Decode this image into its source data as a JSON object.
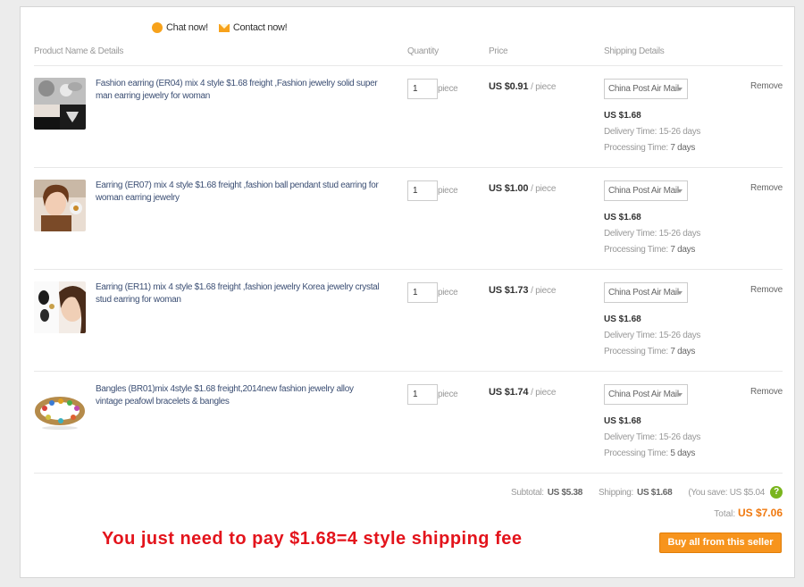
{
  "seller": {
    "chat_label": "Chat now!",
    "contact_label": "Contact now!"
  },
  "columns": {
    "product": "Product Name & Details",
    "quantity": "Quantity",
    "price": "Price",
    "shipping": "Shipping Details"
  },
  "items": [
    {
      "title": "Fashion earring (ER04) mix 4 style $1.68 freight ,Fashion jewelry solid super man earring jewelry for woman",
      "quantity": "1",
      "unit": "piece",
      "price": "US $0.91",
      "per": "/ piece",
      "shipping_method": "China Post Air Mail",
      "shipping_cost": "US $1.68",
      "delivery_label": "Delivery Time:",
      "delivery_time": "15-26 days",
      "processing_label": "Processing Time:",
      "processing_time": "7 days",
      "remove_label": "Remove"
    },
    {
      "title": "Earring (ER07) mix 4 style $1.68 freight ,fashion ball pendant stud earring for woman earring jewelry",
      "quantity": "1",
      "unit": "piece",
      "price": "US $1.00",
      "per": "/ piece",
      "shipping_method": "China Post Air Mail",
      "shipping_cost": "US $1.68",
      "delivery_label": "Delivery Time:",
      "delivery_time": "15-26 days",
      "processing_label": "Processing Time:",
      "processing_time": "7 days",
      "remove_label": "Remove"
    },
    {
      "title": "Earring (ER11) mix 4 style $1.68 freight ,fashion jewelry Korea jewelry crystal stud earring for woman",
      "quantity": "1",
      "unit": "piece",
      "price": "US $1.73",
      "per": "/ piece",
      "shipping_method": "China Post Air Mail",
      "shipping_cost": "US $1.68",
      "delivery_label": "Delivery Time:",
      "delivery_time": "15-26 days",
      "processing_label": "Processing Time:",
      "processing_time": "7 days",
      "remove_label": "Remove"
    },
    {
      "title": "Bangles (BR01)mix 4style $1.68 freight,2014new fashion jewelry alloy vintage peafowl bracelets & bangles",
      "quantity": "1",
      "unit": "piece",
      "price": "US $1.74",
      "per": "/ piece",
      "shipping_method": "China Post Air Mail",
      "shipping_cost": "US $1.68",
      "delivery_label": "Delivery Time:",
      "delivery_time": "15-26 days",
      "processing_label": "Processing Time:",
      "processing_time": "5 days",
      "remove_label": "Remove"
    }
  ],
  "summary": {
    "subtotal_label": "Subtotal:",
    "subtotal": "US $5.38",
    "shipping_label": "Shipping:",
    "shipping": "US $1.68",
    "save_text": "(You save: US $5.04",
    "help_icon": "?",
    "total_label": "Total:",
    "total": "US $7.06"
  },
  "promo_text": "You just need to pay $1.68=4 style shipping fee",
  "buy_button": "Buy all from this seller",
  "colors": {
    "accent": "#f7941d",
    "promo": "#e3141c",
    "link": "#3c4f74",
    "total": "#f0790f"
  }
}
